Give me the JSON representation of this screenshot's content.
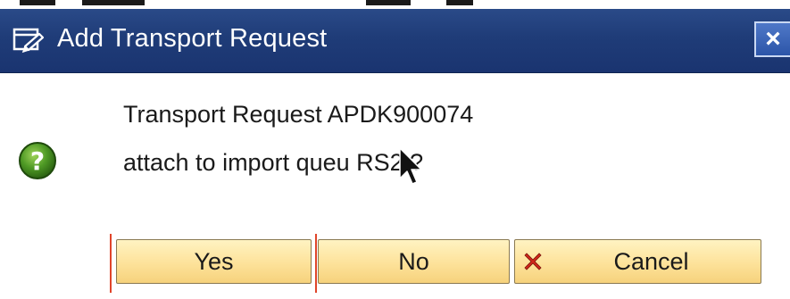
{
  "dialog": {
    "title": "Add Transport Request",
    "close_label": "×"
  },
  "message": {
    "line1": "Transport Request APDK900074",
    "line2": "attach to import queu  RS2 ?"
  },
  "buttons": {
    "yes": "Yes",
    "no": "No",
    "cancel": "Cancel"
  },
  "icons": {
    "title": "dialog-window-icon",
    "question": "question-icon",
    "cancel": "red-x-icon",
    "cursor": "mouse-pointer-icon"
  },
  "colors": {
    "titlebar": "#1f3c78",
    "button": "#fde29a",
    "question_icon": "#3f8a1e",
    "focus": "#e0452a",
    "cancel_x": "#d0261a"
  }
}
